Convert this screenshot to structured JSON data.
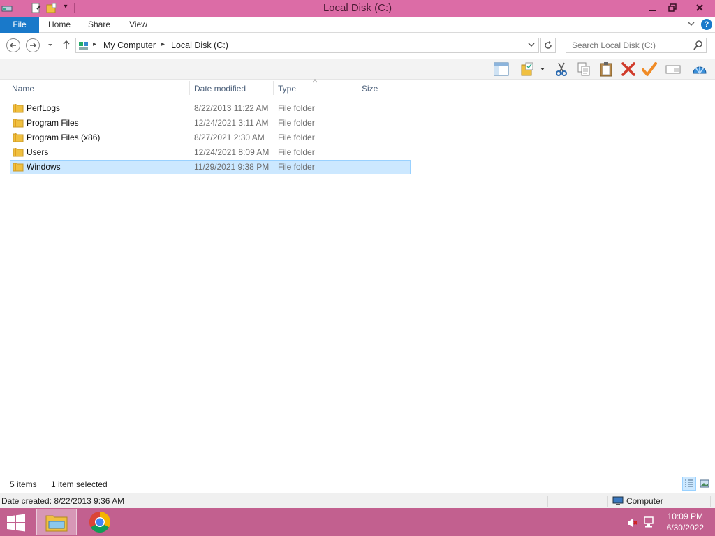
{
  "window": {
    "title": "Local Disk (C:)"
  },
  "titlebar_icons": [
    "drive-icon",
    "properties-icon",
    "new-folder-icon",
    "customize-dropdown-icon"
  ],
  "ribbon": {
    "tabs": [
      "File",
      "Home",
      "Share",
      "View"
    ],
    "expand_icon": "chevron-down-icon",
    "help_glyph": "?"
  },
  "address": {
    "crumbs": [
      "My Computer",
      "Local Disk (C:)"
    ],
    "search_placeholder": "Search Local Disk (C:)"
  },
  "toolbar_icons": [
    "preview-pane-icon",
    "select-folder-icon",
    "cut-icon",
    "copy-icon",
    "paste-icon",
    "delete-icon",
    "check-icon",
    "rename-icon",
    "shell-icon"
  ],
  "columns": [
    "Name",
    "Date modified",
    "Type",
    "Size"
  ],
  "files": [
    {
      "name": "PerfLogs",
      "date": "8/22/2013 11:22 AM",
      "type": "File folder",
      "size": ""
    },
    {
      "name": "Program Files",
      "date": "12/24/2021 3:11 AM",
      "type": "File folder",
      "size": ""
    },
    {
      "name": "Program Files (x86)",
      "date": "8/27/2021 2:30 AM",
      "type": "File folder",
      "size": ""
    },
    {
      "name": "Users",
      "date": "12/24/2021 8:09 AM",
      "type": "File folder",
      "size": ""
    },
    {
      "name": "Windows",
      "date": "11/29/2021 9:38 PM",
      "type": "File folder",
      "size": "",
      "selected": true
    }
  ],
  "status": {
    "item_count": "5 items",
    "selection": "1 item selected"
  },
  "details": {
    "date_created": "Date created: 8/22/2013 9:36 AM",
    "location": "Computer"
  },
  "taskbar": {
    "time": "10:09 PM",
    "date": "6/30/2022"
  },
  "colors": {
    "titlebar": "#dc6ca6",
    "taskbar": "#c2608f",
    "file_tab": "#1979ca",
    "selection_fill": "#cce8ff",
    "selection_border": "#99d1ff",
    "folder": "#f0c040"
  }
}
